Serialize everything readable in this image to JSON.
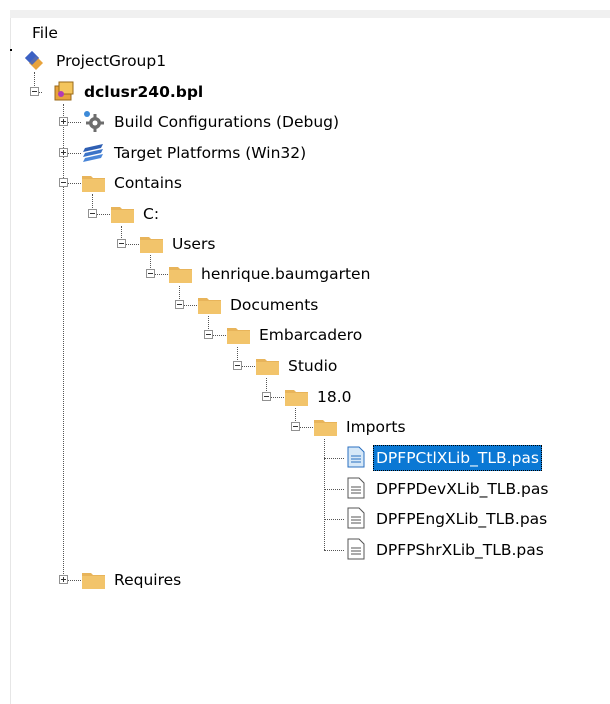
{
  "menu": {
    "file_label": "File"
  },
  "tree": {
    "project_group": "ProjectGroup1",
    "package": "dclusr240.bpl",
    "build_configurations": "Build Configurations (Debug)",
    "target_platforms": "Target Platforms (Win32)",
    "contains": "Contains",
    "folders": [
      "C:",
      "Users",
      "henrique.baumgarten",
      "Documents",
      "Embarcadero",
      "Studio",
      "18.0",
      "Imports"
    ],
    "files": [
      "DPFPCtlXLib_TLB.pas",
      "DPFPDevXLib_TLB.pas",
      "DPFPEngXLib_TLB.pas",
      "DPFPShrXLib_TLB.pas"
    ],
    "selected_file_index": 0,
    "requires": "Requires"
  },
  "colors": {
    "selection": "#0a78d4",
    "folder": "#e8b45a",
    "project_group_icon": "#3c62c4"
  }
}
